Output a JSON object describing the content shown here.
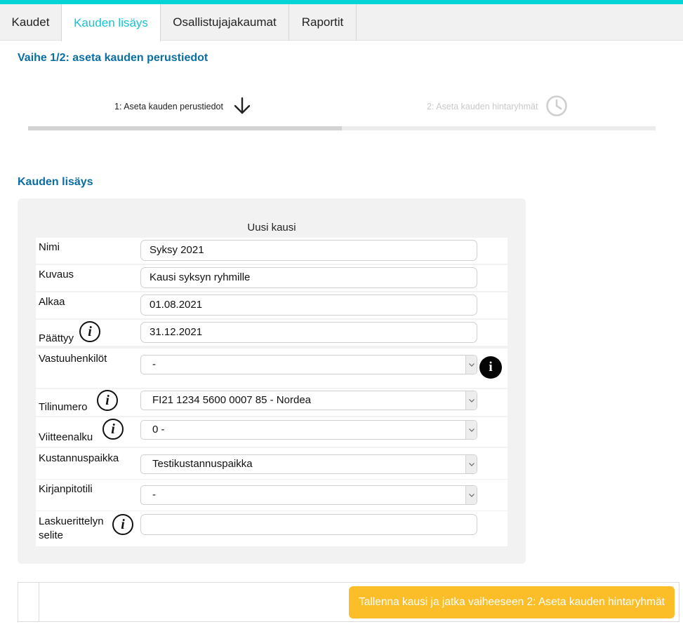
{
  "tabs": [
    {
      "label": "Kaudet"
    },
    {
      "label": "Kauden lisäys"
    },
    {
      "label": "Osallistujajakaumat"
    },
    {
      "label": "Raportit"
    }
  ],
  "wizard": {
    "title": "Vaihe 1/2: aseta kauden perustiedot",
    "progress_fraction": 0.5,
    "steps": [
      {
        "label": "1: Aseta kauden perustiedot",
        "icon": "arrow-down-icon",
        "state": "current"
      },
      {
        "label": "2: Aseta kauden hintaryhmät",
        "icon": "clock-icon",
        "state": "pending"
      }
    ]
  },
  "form": {
    "section_title": "Kauden lisäys",
    "caption": "Uusi kausi",
    "fields": {
      "nimi": {
        "label": "Nimi",
        "value": "Syksy 2021"
      },
      "kuvaus": {
        "label": "Kuvaus",
        "value": "Kausi syksyn ryhmille"
      },
      "alkaa": {
        "label": "Alkaa",
        "value": "01.08.2021"
      },
      "paattyy": {
        "label": "Päättyy",
        "value": "31.12.2021"
      },
      "vastuuhenkilot": {
        "label": "Vastuuhenkilöt",
        "value": "-"
      },
      "tilinumero": {
        "label": "Tilinumero",
        "value": "FI21 1234 5600 0007 85 - Nordea"
      },
      "viitteenalku": {
        "label": "Viitteenalku",
        "value": "0 -"
      },
      "kustannuspaikka": {
        "label": "Kustannuspaikka",
        "value": "Testikustannuspaikka"
      },
      "kirjanpitotili": {
        "label": "Kirjanpitotili",
        "value": "-"
      },
      "laskuerittelyn": {
        "label_line1": "Laskuerittelyn",
        "label_line2": "selite",
        "value": ""
      }
    }
  },
  "actions": {
    "save_label": "Tallenna kausi ja jatka vaiheeseen 2: Aseta kauden hintaryhmät"
  },
  "colors": {
    "accent": "#00d4d4",
    "active_tab": "#19c3d3",
    "heading": "#0a6ea3",
    "save_button": "#fbbd28"
  }
}
